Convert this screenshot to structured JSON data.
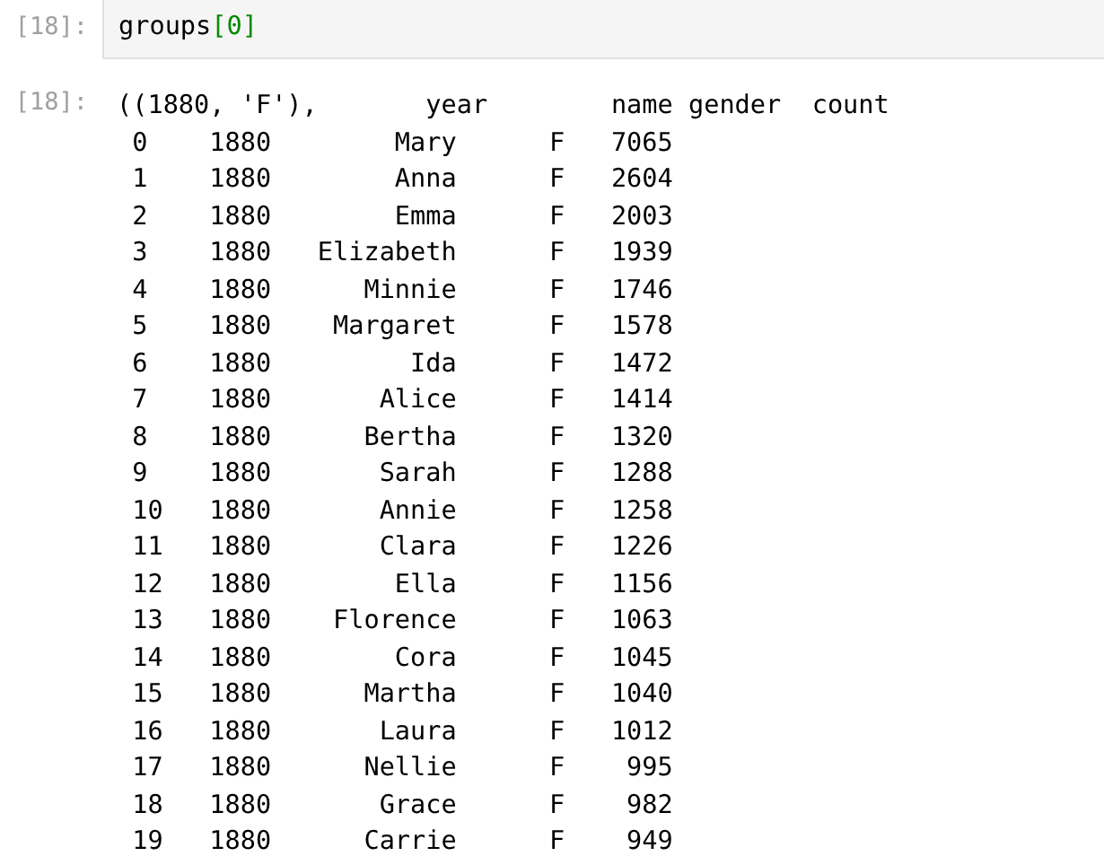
{
  "input_cell": {
    "prompt": "[18]:",
    "code": [
      {
        "text": "groups",
        "kind": "name"
      },
      {
        "text": "[",
        "kind": "bracket"
      },
      {
        "text": "0",
        "kind": "number"
      },
      {
        "text": "]",
        "kind": "bracket"
      }
    ]
  },
  "output_cell": {
    "prompt": "[18]:",
    "lines": [
      "((1880, 'F'),       year        name gender  count",
      " 0    1880        Mary      F   7065",
      " 1    1880        Anna      F   2604",
      " 2    1880        Emma      F   2003",
      " 3    1880   Elizabeth      F   1939",
      " 4    1880      Minnie      F   1746",
      " 5    1880    Margaret      F   1578",
      " 6    1880         Ida      F   1472",
      " 7    1880       Alice      F   1414",
      " 8    1880      Bertha      F   1320",
      " 9    1880       Sarah      F   1288",
      " 10   1880       Annie      F   1258",
      " 11   1880       Clara      F   1226",
      " 12   1880        Ella      F   1156",
      " 13   1880    Florence      F   1063",
      " 14   1880        Cora      F   1045",
      " 15   1880      Martha      F   1040",
      " 16   1880       Laura      F   1012",
      " 17   1880      Nellie      F    995",
      " 18   1880       Grace      F    982",
      " 19   1880      Carrie      F    949"
    ]
  }
}
